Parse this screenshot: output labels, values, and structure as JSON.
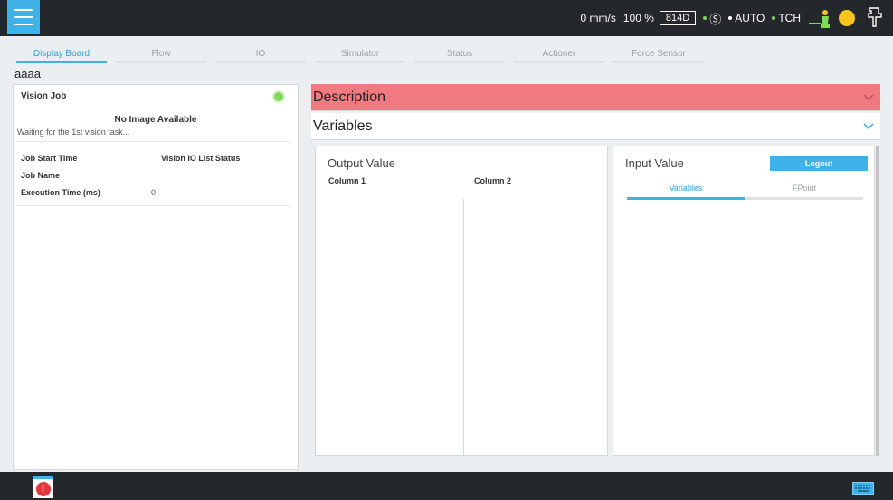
{
  "header": {
    "speed": "0 mm/s",
    "speed_percent": "100 %",
    "project_id": "814D",
    "safety_mode_icon": "Ⓢ",
    "operation_mode": "AUTO",
    "tcp_mode": "TCH",
    "status_dot_color": "#7ed957",
    "indicator_color": "#f8c51c"
  },
  "tabs": [
    {
      "label": "Display Board",
      "active": true
    },
    {
      "label": "Flow"
    },
    {
      "label": "IO"
    },
    {
      "label": "Simulator"
    },
    {
      "label": "Status"
    },
    {
      "label": "Actioner"
    },
    {
      "label": "Force Sensor"
    }
  ],
  "page_name": "aaaa",
  "vision_panel": {
    "title": "Vision Job",
    "status_color": "#7ed957",
    "no_image": "No Image Available",
    "waiting": "Waiting for the 1st vision task...",
    "job_start_label": "Job Start Time",
    "io_status_label": "Vision IO List Status",
    "job_name_label": "Job Name",
    "exec_time_label": "Execution Time (ms)",
    "exec_time_value": "0"
  },
  "accordions": {
    "description": "Description",
    "variables": "Variables"
  },
  "output_panel": {
    "title": "Output Value",
    "columns": [
      "Column 1",
      "Column 2"
    ]
  },
  "input_panel": {
    "title": "Input Value",
    "logout": "Logout",
    "subtabs": [
      "Variables",
      "FPoint"
    ]
  },
  "bottom": {
    "alert_symbol": "!"
  },
  "colors": {
    "accent": "#3fb3e8",
    "description_bg": "#f07a80",
    "topbar": "#24282c"
  }
}
